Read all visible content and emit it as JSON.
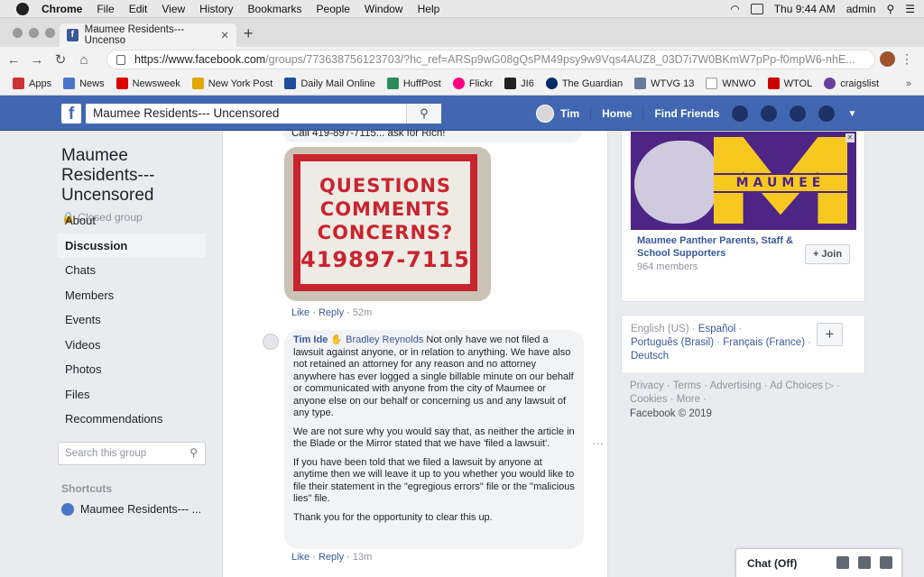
{
  "mac_menu": {
    "app": "Chrome",
    "items": [
      "File",
      "Edit",
      "View",
      "History",
      "Bookmarks",
      "People",
      "Window",
      "Help"
    ],
    "clock": "Thu 9:44 AM",
    "user": "admin"
  },
  "browser": {
    "tab_title": "Maumee Residents--- Uncenso",
    "url_host": "https://www.facebook.com",
    "url_path": "/groups/773638756123703/?hc_ref=ARSp9wG08gQsPM49psy9w9Vqs4AUZ8_03D7i7W0BKmW7pPp-f0mpW6-nhE...",
    "bookmarks": [
      "Apps",
      "News",
      "Newsweek",
      "New York Post",
      "Daily Mail Online",
      "HuffPost",
      "Flickr",
      "JI6",
      "The Guardian",
      "WTVG 13",
      "WNWO",
      "WTOL",
      "craigslist"
    ],
    "bookmarks_more": "»"
  },
  "fb": {
    "search_value": "Maumee Residents--- Uncensored",
    "user": "Tim",
    "home": "Home",
    "find_friends": "Find Friends"
  },
  "group": {
    "title": "Maumee Residents--- Uncensored",
    "privacy": "Closed group",
    "nav": [
      "About",
      "Discussion",
      "Chats",
      "Members",
      "Events",
      "Videos",
      "Photos",
      "Files",
      "Recommendations"
    ],
    "search_placeholder": "Search this group",
    "shortcuts_label": "Shortcuts",
    "shortcut_item": "Maumee Residents--- ..."
  },
  "post": {
    "top_comment_text": "Call 419-897-7115... ask for Rich!",
    "sign_lines": [
      "QUESTIONS",
      "COMMENTS",
      "CONCERNS?",
      "419897-7115"
    ],
    "action1": {
      "like": "Like",
      "reply": "Reply",
      "time": "52m"
    },
    "comment": {
      "author": "Tim Ide",
      "tag": "Bradley Reynolds",
      "p1": "Not only have we not filed a lawsuit against anyone, or in relation to anything. We have also not retained an attorney for any reason and no attorney anywhere has ever logged a single billable minute on our behalf or communicated with anyone from the city of Maumee or anyone else on our behalf or concerning us and any lawsuit of any type.",
      "p2": "We are not sure why you would say that, as neither the article in the Blade or the Mirror stated that we have 'filed a lawsuit'.",
      "p3": "If you have been told that we filed a lawsuit by anyone at anytime then we will leave it up to you whether you would like to file their statement in the \"egregious errors\" file or the \"malicious lies\" file.",
      "p4": "Thank you for the opportunity to clear this up."
    },
    "action2": {
      "like": "Like",
      "reply": "Reply",
      "time": "13m"
    }
  },
  "ad": {
    "image_text": "MAUMEE",
    "name": "Maumee Panther Parents, Staff & School Supporters",
    "members": "964 members",
    "join": "+ Join"
  },
  "languages": {
    "current": "English (US)",
    "others": [
      "Español",
      "Português (Brasil)",
      "Français (France)",
      "Deutsch"
    ]
  },
  "footer": {
    "links": [
      "Privacy",
      "Terms",
      "Advertising",
      "Ad Choices",
      "Cookies",
      "More"
    ],
    "copyright": "Facebook © 2019"
  },
  "chat": {
    "label": "Chat (Off)"
  },
  "colors": {
    "fb_blue": "#4267b2",
    "link": "#385898",
    "sign_red": "#c8242e",
    "ad_purple": "#4e2585",
    "ad_gold": "#f7c920"
  }
}
